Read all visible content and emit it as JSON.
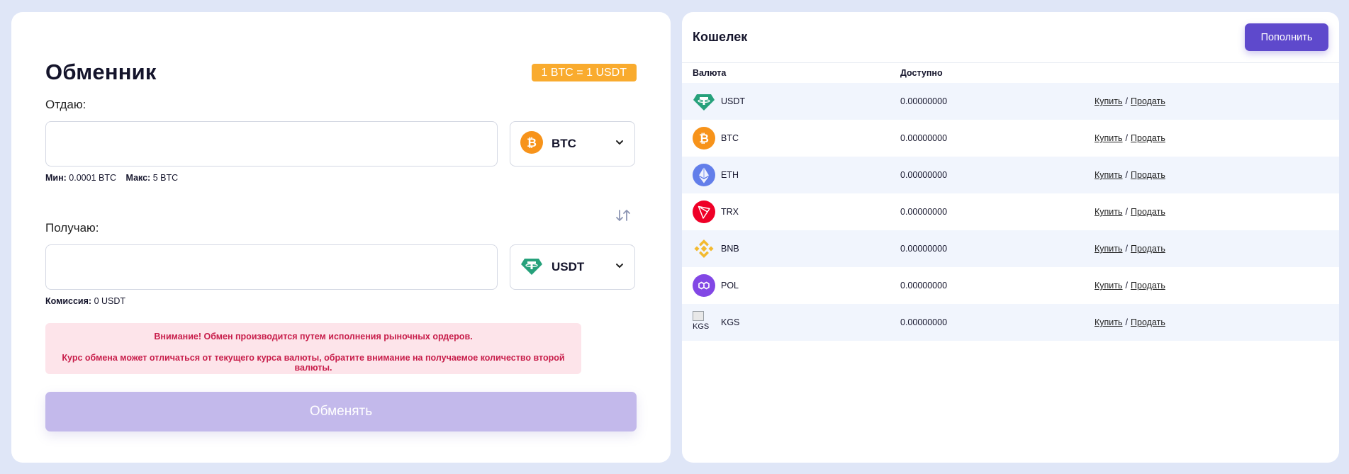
{
  "exchanger": {
    "title": "Обменник",
    "rate_badge": "1 BTC = 1 USDT",
    "give": {
      "label": "Отдаю:",
      "value": "",
      "currency": "BTC",
      "limits": {
        "min_label": "Мин:",
        "min_value": "0.0001 BTC",
        "max_label": "Макс:",
        "max_value": "5 BTC"
      }
    },
    "receive": {
      "label": "Получаю:",
      "value": "",
      "currency": "USDT",
      "fee": {
        "label": "Комиссия:",
        "value": "0 USDT"
      }
    },
    "warning": {
      "line1": "Внимание! Обмен производится путем исполнения рыночных ордеров.",
      "line2": "Курс обмена может отличаться от текущего курса валюты, обратите внимание на получаемое количество второй валюты."
    },
    "submit_label": "Обменять"
  },
  "wallet": {
    "title": "Кошелек",
    "topup_label": "Пополнить",
    "columns": {
      "currency": "Валюта",
      "available": "Доступно"
    },
    "buy_label": "Купить",
    "separator": "/",
    "sell_label": "Продать",
    "rows": [
      {
        "code": "USDT",
        "available": "0.00000000",
        "icon": "tether-icon"
      },
      {
        "code": "BTC",
        "available": "0.00000000",
        "icon": "bitcoin-icon"
      },
      {
        "code": "ETH",
        "available": "0.00000000",
        "icon": "ethereum-icon"
      },
      {
        "code": "TRX",
        "available": "0.00000000",
        "icon": "tron-icon"
      },
      {
        "code": "BNB",
        "available": "0.00000000",
        "icon": "bnb-icon"
      },
      {
        "code": "POL",
        "available": "0.00000000",
        "icon": "polygon-icon"
      },
      {
        "code": "KGS",
        "available": "0.00000000",
        "icon": "broken-image-icon",
        "icon_alt": "KGS"
      }
    ]
  },
  "colors": {
    "accent": "#5e49cc",
    "submit_disabled": "#c3b9eb",
    "badge": "#f9ab2e",
    "warning_bg": "#fde4ea",
    "warning_text": "#c81e4b",
    "row_alt": "#f1f5fd",
    "page_bg": "#dfe6f7"
  }
}
